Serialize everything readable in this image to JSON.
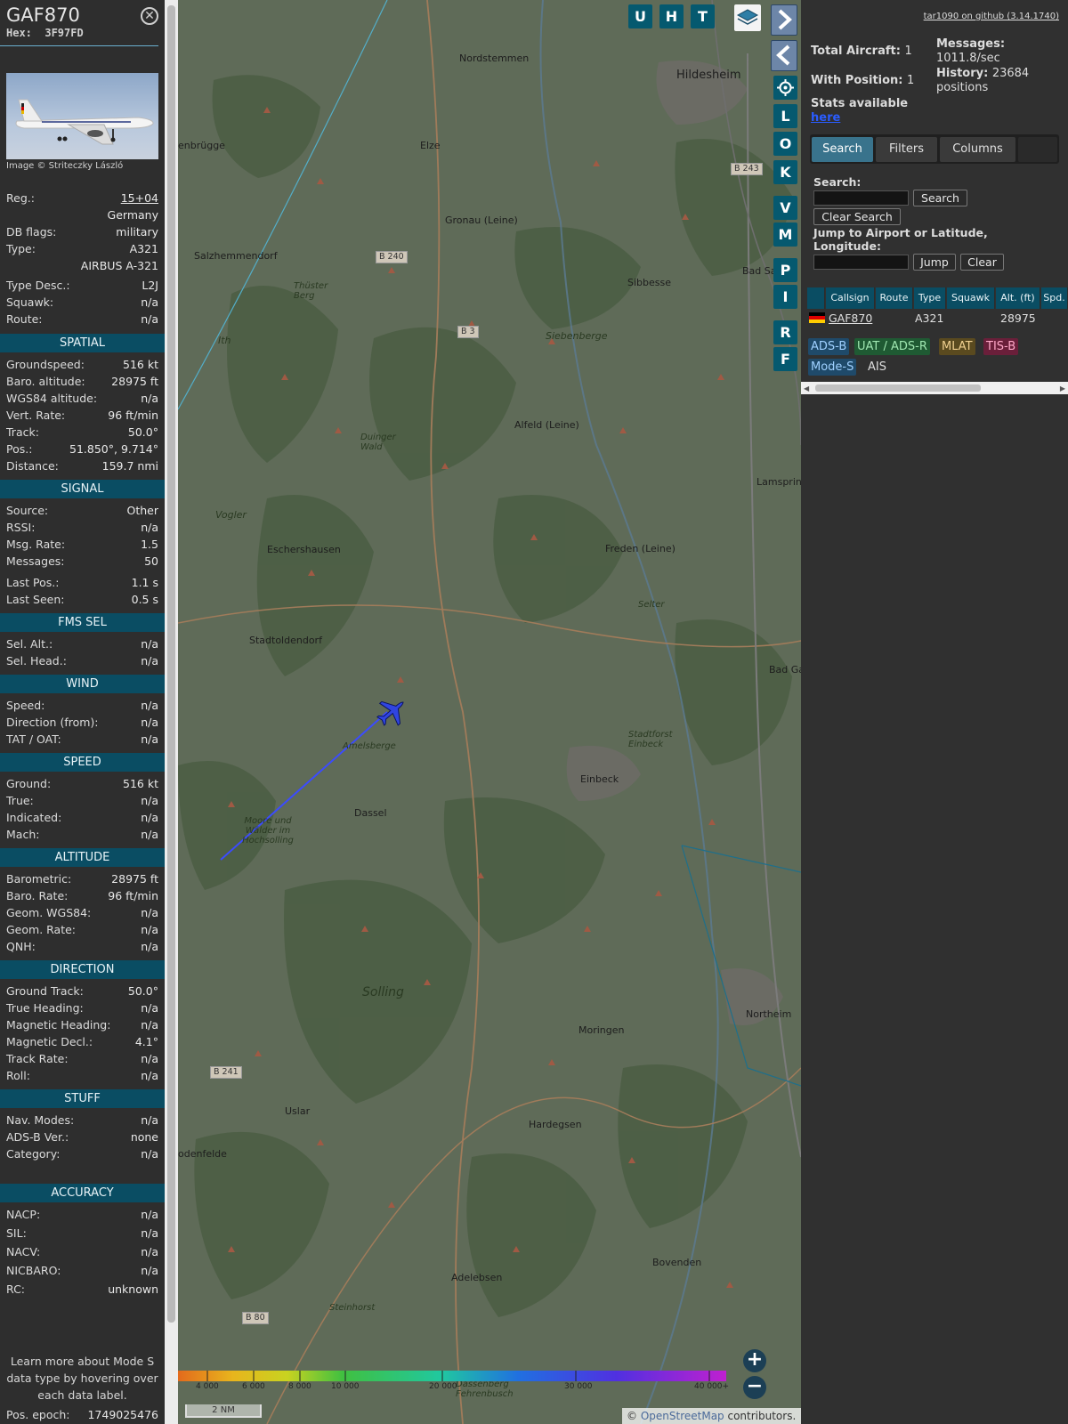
{
  "infoblock": {
    "callsign": "GAF870",
    "hex_label": "Hex:",
    "hex": "3F97FD",
    "image_credit": "Image © Striteczky László",
    "general": [
      {
        "k": "Reg.:",
        "v": "15+04"
      },
      {
        "k": "",
        "v": "Germany"
      },
      {
        "k": "DB flags:",
        "v": "military"
      },
      {
        "k": "Type:",
        "v": "A321"
      },
      {
        "k": "",
        "v": "AIRBUS A-321"
      },
      {
        "k": "Type Desc.:",
        "v": "L2J"
      },
      {
        "k": "Squawk:",
        "v": "n/a"
      },
      {
        "k": "Route:",
        "v": "n/a"
      }
    ],
    "sections": [
      {
        "title": "SPATIAL",
        "rows": [
          {
            "k": "Groundspeed:",
            "v": "516 kt"
          },
          {
            "k": "Baro. altitude:",
            "v": "28975 ft"
          },
          {
            "k": "WGS84 altitude:",
            "v": "n/a"
          },
          {
            "k": "Vert. Rate:",
            "v": "96 ft/min"
          },
          {
            "k": "Track:",
            "v": "50.0°"
          },
          {
            "k": "Pos.:",
            "v": "51.850°, 9.714°"
          },
          {
            "k": "Distance:",
            "v": "159.7 nmi"
          }
        ]
      },
      {
        "title": "SIGNAL",
        "rows": [
          {
            "k": "Source:",
            "v": "Other"
          },
          {
            "k": "RSSI:",
            "v": "n/a"
          },
          {
            "k": "Msg. Rate:",
            "v": "1.5"
          },
          {
            "k": "Messages:",
            "v": "50"
          },
          {
            "k": "Last Pos.:",
            "v": "1.1 s"
          },
          {
            "k": "Last Seen:",
            "v": "0.5 s"
          }
        ]
      },
      {
        "title": "FMS SEL",
        "rows": [
          {
            "k": "Sel. Alt.:",
            "v": "n/a"
          },
          {
            "k": "Sel. Head.:",
            "v": "n/a"
          }
        ]
      },
      {
        "title": "WIND",
        "rows": [
          {
            "k": "Speed:",
            "v": "n/a"
          },
          {
            "k": "Direction (from):",
            "v": "n/a"
          },
          {
            "k": "TAT / OAT:",
            "v": "n/a"
          }
        ]
      },
      {
        "title": "SPEED",
        "rows": [
          {
            "k": "Ground:",
            "v": "516 kt"
          },
          {
            "k": "True:",
            "v": "n/a"
          },
          {
            "k": "Indicated:",
            "v": "n/a"
          },
          {
            "k": "Mach:",
            "v": "n/a"
          }
        ]
      },
      {
        "title": "ALTITUDE",
        "rows": [
          {
            "k": "Barometric:",
            "v": "28975 ft"
          },
          {
            "k": "Baro. Rate:",
            "v": "96 ft/min"
          },
          {
            "k": "Geom. WGS84:",
            "v": "n/a"
          },
          {
            "k": "Geom. Rate:",
            "v": "n/a"
          },
          {
            "k": "QNH:",
            "v": "n/a"
          }
        ]
      },
      {
        "title": "DIRECTION",
        "rows": [
          {
            "k": "Ground Track:",
            "v": "50.0°"
          },
          {
            "k": "True Heading:",
            "v": "n/a"
          },
          {
            "k": "Magnetic Heading:",
            "v": "n/a"
          },
          {
            "k": "Magnetic Decl.:",
            "v": "4.1°"
          },
          {
            "k": "Track Rate:",
            "v": "n/a"
          },
          {
            "k": "Roll:",
            "v": "n/a"
          }
        ]
      },
      {
        "title": "STUFF",
        "rows": [
          {
            "k": "Nav. Modes:",
            "v": "n/a"
          },
          {
            "k": "ADS-B Ver.:",
            "v": "none"
          },
          {
            "k": "Category:",
            "v": "n/a"
          }
        ]
      },
      {
        "title": "ACCURACY",
        "rows": [
          {
            "k": "NACP:",
            "v": "n/a"
          },
          {
            "k": "SIL:",
            "v": "n/a"
          },
          {
            "k": "NACV:",
            "v": "n/a"
          },
          {
            "k": "NICBARO:",
            "v": "n/a"
          },
          {
            "k": "RC:",
            "v": "unknown"
          }
        ]
      }
    ],
    "note": "Learn more about Mode S data type by hovering over each data label.",
    "epoch_label": "Pos. epoch:",
    "epoch": "1749025476"
  },
  "map": {
    "buttons_top": [
      "U",
      "H",
      "T"
    ],
    "buttons_side": [
      "L",
      "O",
      "K",
      "V",
      "M",
      "P",
      "I",
      "R",
      "F"
    ],
    "places": [
      {
        "name": "Nordstemmen"
      },
      {
        "name": "Hildesheim"
      },
      {
        "name": "Elze"
      },
      {
        "name": "enbrügge"
      },
      {
        "name": "Gronau (Leine)"
      },
      {
        "name": "Salzhemmendorf"
      },
      {
        "name": "Sibbesse"
      },
      {
        "name": "Bad Sa"
      },
      {
        "name": "Siebenberge"
      },
      {
        "name": "Ith"
      },
      {
        "name": "Alfeld (Leine)"
      },
      {
        "name": "Lamspring"
      },
      {
        "name": "Vogler"
      },
      {
        "name": "Eschershausen"
      },
      {
        "name": "Freden (Leine)"
      },
      {
        "name": "Stadtoldendorf"
      },
      {
        "name": "Bad Ga"
      },
      {
        "name": "Amelsberge"
      },
      {
        "name": "Einbeck"
      },
      {
        "name": "Dassel"
      },
      {
        "name": "Solling"
      },
      {
        "name": "Northeim"
      },
      {
        "name": "Moringen"
      },
      {
        "name": "Uslar"
      },
      {
        "name": "Hardegsen"
      },
      {
        "name": "odenfelde"
      },
      {
        "name": "Bovenden"
      },
      {
        "name": "Adelebsen"
      },
      {
        "name": "Steinhorst"
      }
    ],
    "italic_places": [
      "Thüster Berg",
      "Duinger Wald",
      "Selter",
      "Stadtforst Einbeck",
      "Moore und Wälder im Hochsolling",
      "Dassenberg Fehrenbusch"
    ],
    "road_signs": [
      "B 243",
      "B 240",
      "B 3",
      "B 241",
      "B 80"
    ],
    "altitude_ticks": [
      "4 000",
      "6 000",
      "8 000",
      "10 000",
      "20 000",
      "30 000",
      "40 000+"
    ],
    "scale": "2 NM",
    "attribution_prefix": "© ",
    "attribution_link": "OpenStreetMap",
    "attribution_suffix": " contributors.",
    "zoom_in": "+",
    "zoom_out": "−"
  },
  "sidebar": {
    "version_link": "tar1090 on github (3.14.1740)",
    "total_aircraft_label": "Total Aircraft:",
    "total_aircraft": "1",
    "with_position_label": "With Position:",
    "with_position": "1",
    "messages_label": "Messages:",
    "messages_rate": "1011.8/sec",
    "history_label": "History:",
    "history_value": "23684 positions",
    "stats_label": "Stats available",
    "stats_link": "here",
    "tabs": [
      "Search",
      "Filters",
      "Columns"
    ],
    "search_label": "Search:",
    "search_button": "Search",
    "clear_search_button": "Clear Search",
    "jump_label": "Jump to Airport or Latitude, Longitude:",
    "jump_button": "Jump",
    "clear_button": "Clear",
    "table_headers": [
      "Callsign",
      "Route",
      "Type",
      "Squawk",
      "Alt. (ft)",
      "Spd."
    ],
    "table_row": {
      "callsign": "GAF870",
      "route": "",
      "type": "A321",
      "squawk": "",
      "alt": "28975",
      "spd": ""
    },
    "source_tags": [
      {
        "label": "ADS-B",
        "bg": "#1f4a6a",
        "fg": "#9fd0ff"
      },
      {
        "label": "UAT / ADS-R",
        "bg": "#1f5a33",
        "fg": "#9fe6b0"
      },
      {
        "label": "MLAT",
        "bg": "#5a4a1f",
        "fg": "#f0d090"
      },
      {
        "label": "TIS-B",
        "bg": "#6a1f3a",
        "fg": "#ffa8c8"
      },
      {
        "label": "Mode-S",
        "bg": "#1f4a6a",
        "fg": "#9fd0ff"
      },
      {
        "label": "AIS",
        "bg": "#303030",
        "fg": "#dddddd"
      }
    ]
  }
}
